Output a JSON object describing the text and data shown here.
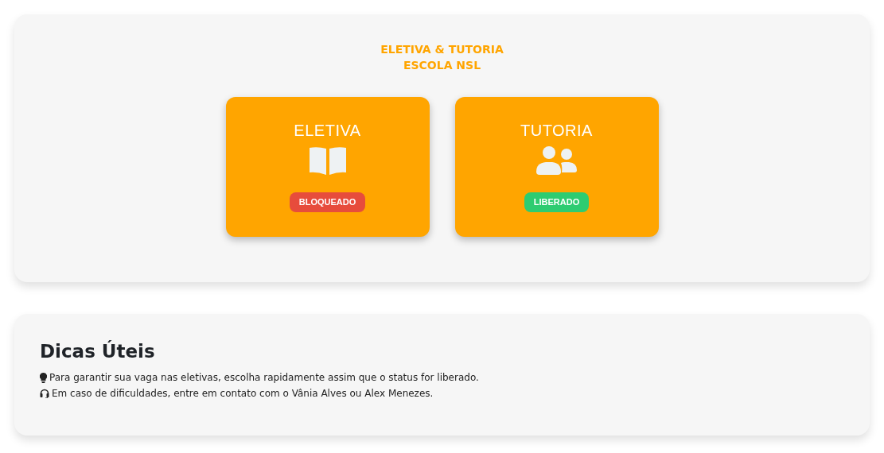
{
  "header": {
    "title_lines": [
      "ELETIVA & TUTORIA",
      "ESCOLA NSL"
    ]
  },
  "cards": [
    {
      "title": "ELETIVA",
      "status": {
        "kind": "locked",
        "label": "BLOQUEADO"
      }
    },
    {
      "title": "TUTORIA",
      "status": {
        "kind": "released",
        "label": "LIBERADO"
      }
    }
  ],
  "tips": {
    "title": "Dicas Úteis",
    "items": [
      {
        "text": "Para garantir sua vaga nas eletivas, escolha rapidamente assim que o status for liberado."
      },
      {
        "text": "Em caso de dificuldades, entre em contato com o Vânia Alves ou Alex Menezes."
      }
    ]
  }
}
